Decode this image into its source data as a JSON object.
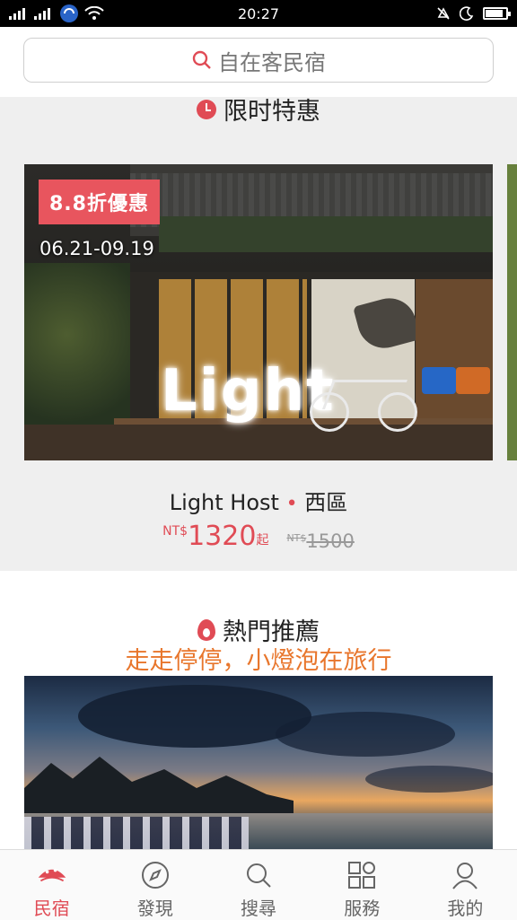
{
  "status_bar": {
    "time": "20:27"
  },
  "search": {
    "placeholder": "自在客民宿"
  },
  "flash_sale": {
    "title": "限时特惠",
    "discount": "8.8折優惠",
    "date_range": "06.21-09.19",
    "neon_sign": "Light",
    "host": "Light Host",
    "district": "西區",
    "price_currency": "NT$",
    "price": "1320",
    "price_suffix": "起",
    "original_currency": "NT$",
    "original_price": "1500"
  },
  "popular": {
    "title": "熱門推薦",
    "subtitle": "走走停停，小燈泡在旅行"
  },
  "colors": {
    "accent": "#e04b55",
    "subtitle": "#e8762c"
  },
  "nav": {
    "items": [
      {
        "label": "民宿",
        "icon": "homestay-icon"
      },
      {
        "label": "發現",
        "icon": "compass-icon"
      },
      {
        "label": "搜尋",
        "icon": "search-icon"
      },
      {
        "label": "服務",
        "icon": "services-grid-icon"
      },
      {
        "label": "我的",
        "icon": "user-icon"
      }
    ],
    "active": 0
  }
}
